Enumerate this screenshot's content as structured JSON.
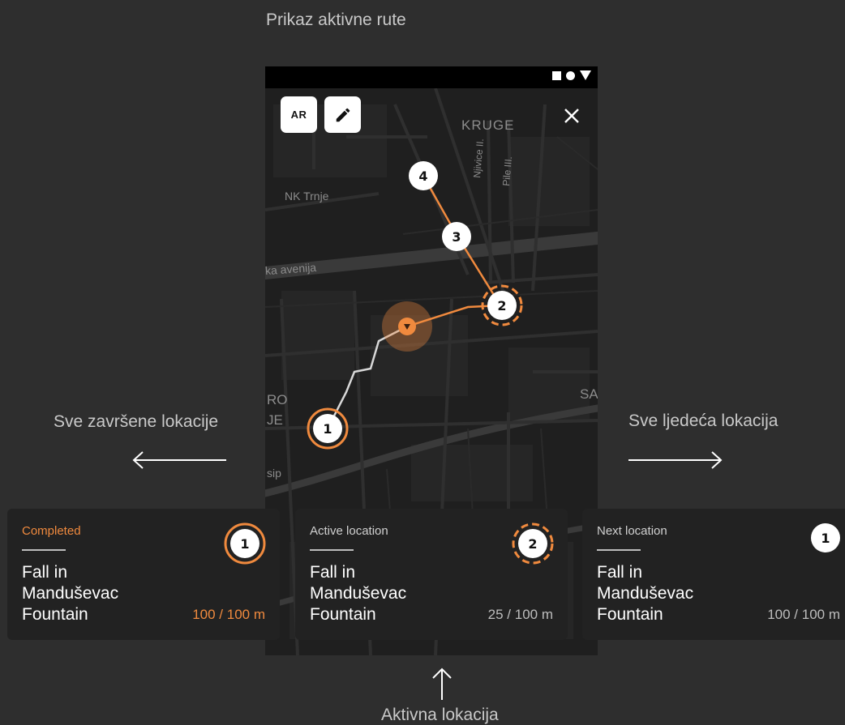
{
  "annotations": {
    "top_title": "Prikaz aktivne rute",
    "left_label": "Sve završene lokacije",
    "right_label": "Sve ljedeća lokacija",
    "bottom_label": "Aktivna lokacija"
  },
  "map": {
    "ar_button": "AR",
    "labels": {
      "kruge": "KRUGE",
      "nk_trnje": "NK Trnje",
      "avenija": "ka avenija",
      "njivice": "Njivice II.",
      "pile": "Pile III.",
      "ro": "RO",
      "je": "JE",
      "sa": "SA",
      "sip": "sip"
    },
    "markers": [
      "4",
      "3",
      "2",
      "1"
    ]
  },
  "cards": [
    {
      "label": "Completed",
      "title_lines": [
        "Fall in",
        "Manduševac",
        "Fountain"
      ],
      "distance": "100 / 100 m",
      "marker": "1"
    },
    {
      "label": "Active location",
      "title_lines": [
        "Fall in",
        "Manduševac",
        "Fountain"
      ],
      "distance": "25 / 100 m",
      "marker": "2"
    },
    {
      "label": "Next location",
      "title_lines": [
        "Fall in",
        "Manduševac",
        "Fountain"
      ],
      "distance": "100 / 100 m",
      "marker": "1"
    }
  ],
  "colors": {
    "accent": "#f08a3e",
    "background": "#2e2e2e",
    "card": "#222222",
    "map": "#1f1f1f"
  },
  "icons": [
    "pencil-icon",
    "close-icon",
    "square-status-icon",
    "circle-status-icon",
    "triangle-status-icon",
    "user-location-icon",
    "arrow-left-icon",
    "arrow-right-icon",
    "arrow-up-icon"
  ]
}
